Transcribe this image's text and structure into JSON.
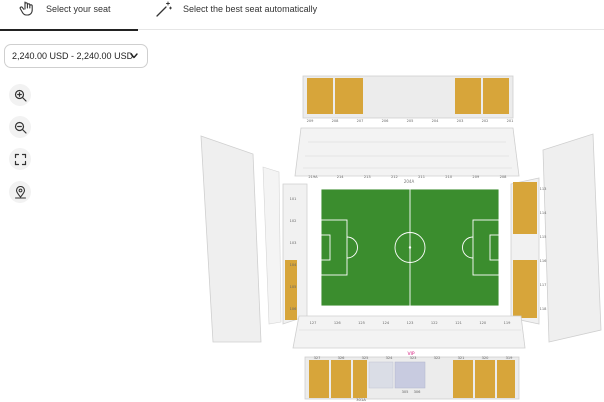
{
  "tabs": [
    {
      "label": "Select your seat",
      "icon": "hand-pointer-icon",
      "active": true
    },
    {
      "label": "Select the best seat automatically",
      "icon": "magic-wand-icon",
      "active": false
    }
  ],
  "price_filter": {
    "value": "2,240.00 USD - 2,240.00 USD"
  },
  "map_controls": [
    {
      "name": "zoom-in-button",
      "icon": "zoom-in-icon"
    },
    {
      "name": "zoom-out-button",
      "icon": "zoom-out-icon"
    },
    {
      "name": "fullscreen-button",
      "icon": "fullscreen-icon"
    },
    {
      "name": "reset-view-button",
      "icon": "map-pin-icon"
    }
  ],
  "stadium": {
    "pitch_color": "#3b8d2e",
    "available_color": "#d7a53a",
    "unavailable_color": "#ececec",
    "section_labels": {
      "top_row": [
        "209",
        "208",
        "207",
        "206",
        "205",
        "204",
        "203",
        "202",
        "201"
      ],
      "upper_mid": [
        "219A",
        "214",
        "213",
        "212",
        "211",
        "210",
        "209",
        "208"
      ],
      "center_label": "204A",
      "right_side": [
        "113",
        "114",
        "115",
        "116",
        "117",
        "118"
      ],
      "left_side": [
        "101",
        "102",
        "103",
        "104",
        "105",
        "106"
      ],
      "bottom_row": [
        "127",
        "126",
        "125",
        "124",
        "123",
        "122",
        "121",
        "120",
        "119"
      ],
      "bottom_lower": [
        "327",
        "326",
        "325",
        "324",
        "323",
        "322",
        "321",
        "320",
        "319"
      ],
      "vip_label": "VIP",
      "bottom_center": [
        "305",
        "306"
      ],
      "bottom_tag": "301A"
    }
  }
}
